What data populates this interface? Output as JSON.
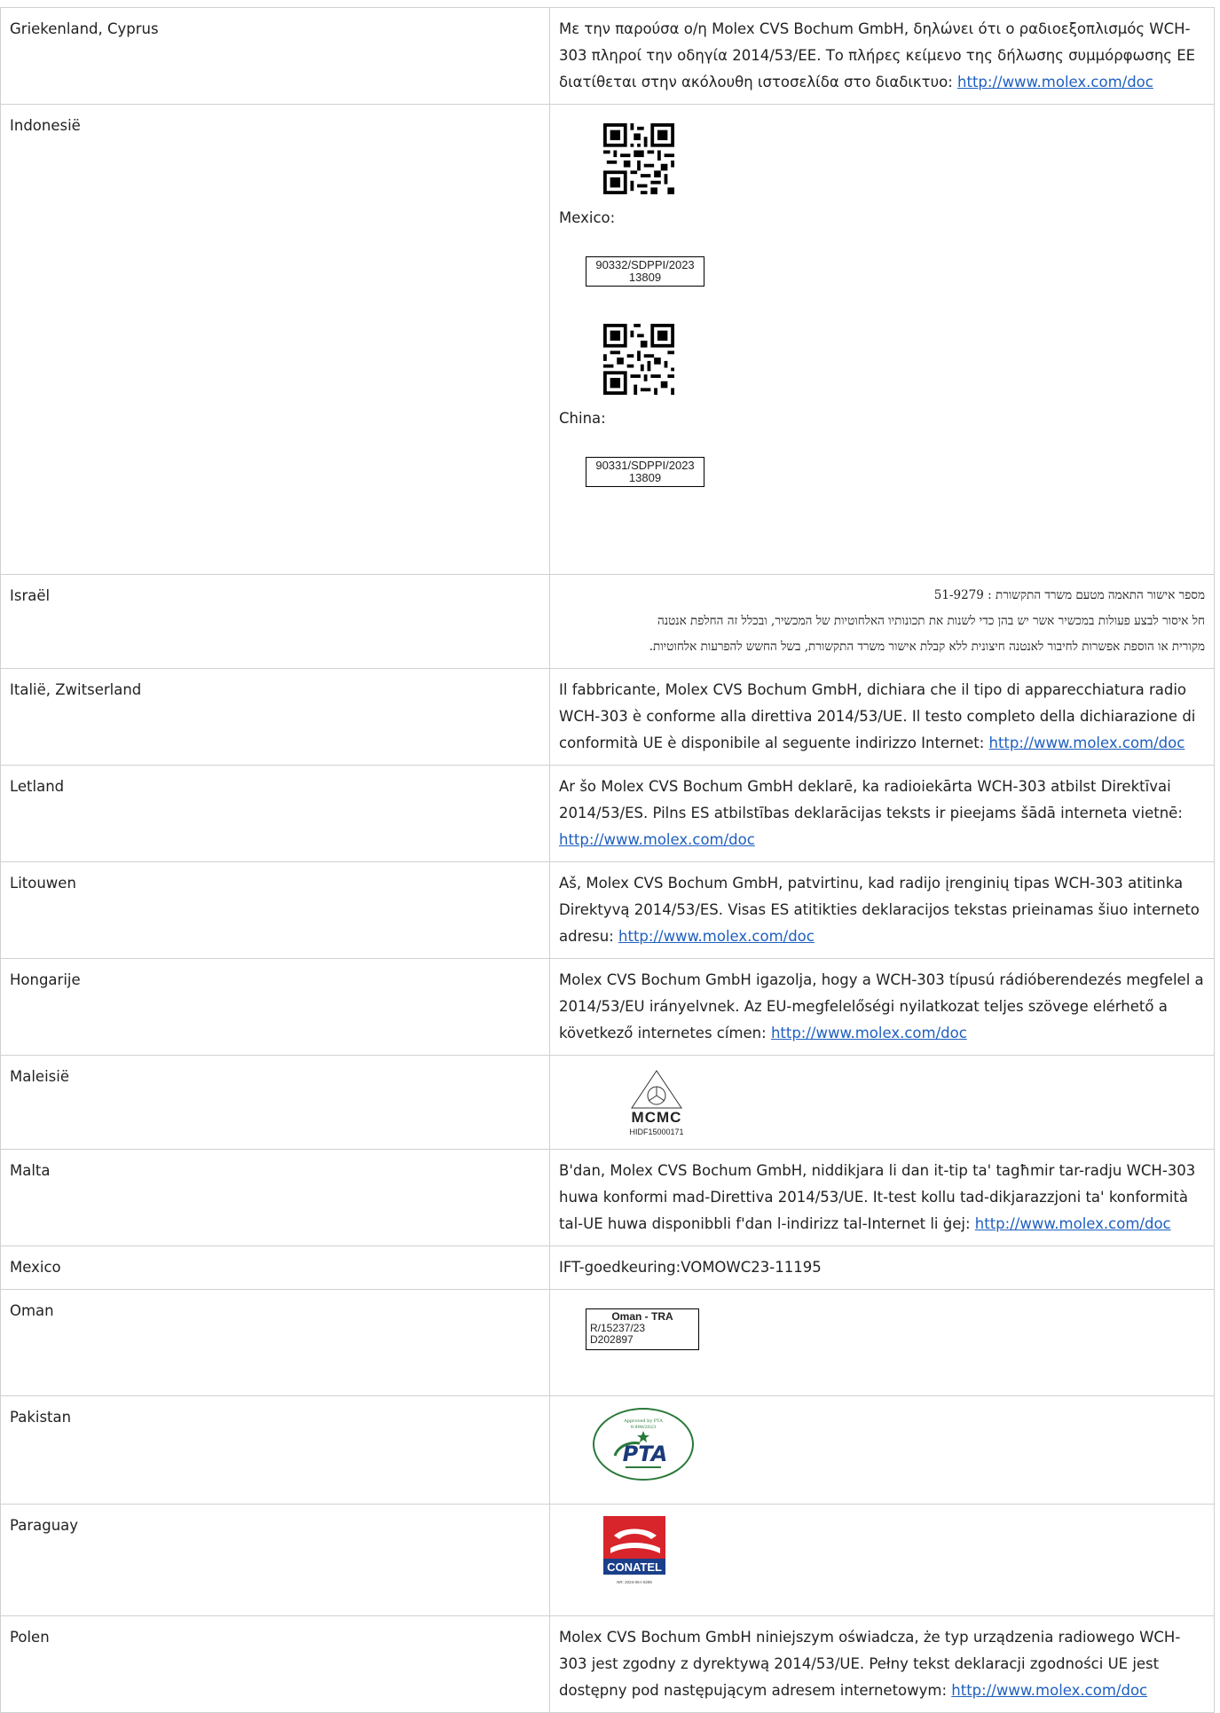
{
  "rows": [
    {
      "country": "Griekenland, Cyprus",
      "text": "Με την παρούσα ο/η Molex CVS Bochum GmbH, δηλώνει ότι ο ραδιοεξοπλισμός WCH-303 πληροί την οδηγία 2014/53/ΕΕ. Το πλήρες κείμενο της δήλωσης συμμόρφωσης ΕΕ διατίθεται στην ακόλουθη ιστοσελίδα στο διαδικτυο: ",
      "link": "http://www.molex.com/doc"
    },
    {
      "country": "Indonesië",
      "mexico_label": "Mexico:",
      "china_label": "China:",
      "cert1_line1": "90332/SDPPI/2023",
      "cert1_line2": "13809",
      "cert2_line1": "90331/SDPPI/2023",
      "cert2_line2": "13809"
    },
    {
      "country": "Israël",
      "line1": "מספר אישור התאמה מטעם משרד התקשורת : 51-9279",
      "line2": "חל איסור לבצע פעולות במכשיר אשר יש בהן כדי לשנות את תכונותיו האלחוטיות של המכשיר, ובכלל זה החלפת אנטנה",
      "line3": "מקורית או הוספת אפשרות לחיבור לאנטנה חיצונית ללא קבלת אישור משרד התקשורת, בשל החשש להפרעות אלחוטיות."
    },
    {
      "country": "Italië, Zwitserland",
      "text": "Il fabbricante, Molex CVS Bochum GmbH, dichiara che il tipo di apparecchiatura radio WCH-303 è conforme alla direttiva 2014/53/UE. Il testo completo della dichiarazione di conformità UE è disponibile al seguente indirizzo Internet: ",
      "link": "http://www.molex.com/doc"
    },
    {
      "country": "Letland",
      "text": "Ar šo Molex CVS Bochum GmbH deklarē, ka radioiekārta WCH-303 atbilst Direktīvai 2014/53/ES. Pilns ES atbilstības deklarācijas teksts ir pieejams šādā interneta vietnē: ",
      "link": "http://www.molex.com/doc"
    },
    {
      "country": "Litouwen",
      "text": "Aš, Molex CVS Bochum GmbH, patvirtinu, kad radijo įrenginių tipas WCH-303 atitinka Direktyvą 2014/53/ES. Visas ES atitikties deklaracijos tekstas prieinamas šiuo interneto adresu: ",
      "link": "http://www.molex.com/doc"
    },
    {
      "country": "Hongarije",
      "text": "Molex CVS Bochum GmbH igazolja, hogy a WCH-303 típusú rádióberendezés megfelel a 2014/53/EU irányelvnek. Az EU-megfelelőségi nyilatkozat teljes szövege elérhető a következő internetes címen: ",
      "link": "http://www.molex.com/doc"
    },
    {
      "country": "Maleisië",
      "logo_text": "MCMC",
      "logo_sub": "HIDF15000171"
    },
    {
      "country": "Malta",
      "text": "B'dan, Molex CVS Bochum GmbH, niddikjara li dan it-tip ta' tagħmir tar-radju WCH-303 huwa konformi mad-Direttiva 2014/53/UE. It-test kollu tad-dikjarazzjoni ta' konformità tal-UE huwa disponibbli f'dan l-indirizz tal-Internet li ġej: ",
      "link": "http://www.molex.com/doc"
    },
    {
      "country": "Mexico",
      "text": "IFT-goedkeuring:VOMOWC23-11195"
    },
    {
      "country": "Oman",
      "label_title": "Oman - TRA",
      "label_line1": "R/15237/23",
      "label_line2": "D202897"
    },
    {
      "country": "Pakistan",
      "logo_top": "Approved by PTA",
      "logo_num": "9.998/2023",
      "logo_text": "PTA"
    },
    {
      "country": "Paraguay",
      "logo_text": "CONATEL",
      "logo_sub": "NR: 2023-06-I-0295"
    },
    {
      "country": "Polen",
      "text": "Molex CVS Bochum GmbH niniejszym oświadcza, że typ urządzenia radiowego WCH-303 jest zgodny z dyrektywą 2014/53/UE. Pełny tekst deklaracji zgodności UE jest dostępny pod następującym adresem internetowym: ",
      "link": "http://www.molex.com/doc"
    }
  ]
}
